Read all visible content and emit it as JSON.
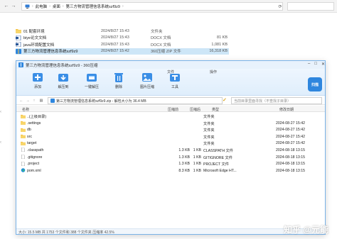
{
  "explorer": {
    "nav": {
      "back": "←",
      "forward": "→",
      "up": "↑"
    },
    "breadcrumb": [
      "此电脑",
      "桌面",
      "第三方物流管理信息系统szf9z9"
    ],
    "search_placeholder": "",
    "files": [
      {
        "name": "01 配套环境",
        "date": "2024/8/27 15:43",
        "type": "文件夹",
        "size": "",
        "icon": "folder-icon",
        "selected": false
      },
      {
        "name": "biye论文文档",
        "date": "2024/8/27 15:43",
        "type": "DOCX 文档",
        "size": "81 KB",
        "icon": "docx-icon",
        "selected": false
      },
      {
        "name": "java环境配置文档",
        "date": "2024/8/27 15:43",
        "type": "DOCX 文档",
        "size": "1,081 KB",
        "icon": "docx-icon",
        "selected": false
      },
      {
        "name": "第三方物流管理信息系统szf9z9",
        "date": "2024/8/27 15:42",
        "type": "360压缩 ZIP 文件",
        "size": "16,318 KB",
        "icon": "zip-icon",
        "selected": true
      }
    ]
  },
  "zip": {
    "title": "第三方物流管理信息系统szf9z9 - 360压缩",
    "ribbon": [
      {
        "label": "添加",
        "icon": "add-icon"
      },
      {
        "label": "解压到",
        "icon": "extract-icon"
      },
      {
        "label": "一键解压",
        "icon": "one-click-extract-icon"
      },
      {
        "label": "删除",
        "icon": "delete-icon"
      },
      {
        "label": "图片压缩",
        "icon": "image-compress-icon"
      },
      {
        "label": "工具",
        "icon": "tools-icon"
      }
    ],
    "ribbon_small": [
      "文件",
      "操作"
    ],
    "logo_text": "扫描",
    "path": "第三方物流管理信息系统szf9z9.zip - 解包大小为 36.4 MB",
    "path_search_placeholder": "当前目录里面寻找（不查找子目录）",
    "headers": {
      "name": "名称",
      "size": "压缩前",
      "csize": "压缩后",
      "type": "类型",
      "date": "修改日期"
    },
    "rows": [
      {
        "name": "..(上级目录)",
        "size": "",
        "csize": "",
        "type": "文件夹",
        "date": "",
        "icon": "folder-icon"
      },
      {
        "name": ".settings",
        "size": "",
        "csize": "",
        "type": "文件夹",
        "date": "2024-08-27 15:42",
        "icon": "folder-icon"
      },
      {
        "name": "db",
        "size": "",
        "csize": "",
        "type": "文件夹",
        "date": "2024-08-27 15:42",
        "icon": "folder-icon"
      },
      {
        "name": "src",
        "size": "",
        "csize": "",
        "type": "文件夹",
        "date": "2024-08-27 15:42",
        "icon": "folder-icon"
      },
      {
        "name": "target",
        "size": "",
        "csize": "",
        "type": "文件夹",
        "date": "2024-08-27 15:42",
        "icon": "folder-icon"
      },
      {
        "name": ".classpath",
        "size": "1.3 KB",
        "csize": "1 KB",
        "type": "CLASSPATH 文件",
        "date": "2024-08-18 13:15",
        "icon": "file-icon"
      },
      {
        "name": ".gitignore",
        "size": "1.3 KB",
        "csize": "1 KB",
        "type": "GITIGNORE 文件",
        "date": "2024-08-18 13:15",
        "icon": "file-icon"
      },
      {
        "name": ".project",
        "size": "1.3 KB",
        "csize": "1 KB",
        "type": "PROJECT 文件",
        "date": "2024-08-18 13:15",
        "icon": "file-icon"
      },
      {
        "name": "pom.xml",
        "size": "8.3 KB",
        "csize": "1 KB",
        "type": "Microsoft Edge HT...",
        "date": "2024-08-18 13:15",
        "icon": "edge-icon"
      }
    ],
    "status": "大小: 15.5 MB 共 1753 个文件和 388 个文件夹 压缩率 42.5%"
  },
  "watermark": "知乎 @元能"
}
